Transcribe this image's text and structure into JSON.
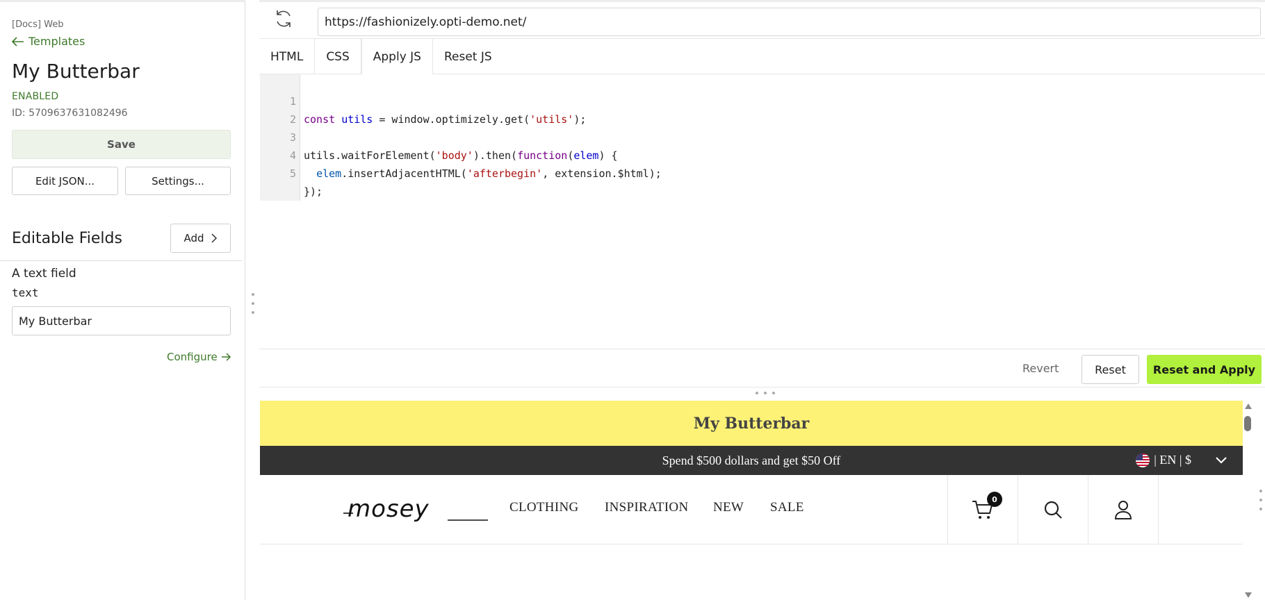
{
  "sidebar": {
    "project": "[Docs] Web",
    "back_label": "Templates",
    "title": "My Butterbar",
    "status": "ENABLED",
    "id_text": "ID: 5709637631082496",
    "save_label": "Save",
    "edit_json_label": "Edit JSON...",
    "settings_label": "Settings...",
    "fields_title": "Editable Fields",
    "add_label": "Add",
    "field": {
      "label": "A text field",
      "key": "text",
      "value": "My Butterbar"
    },
    "configure_label": "Configure"
  },
  "topbar": {
    "url": "https://fashionizely.opti-demo.net/",
    "refresh_icon": "refresh-icon"
  },
  "tabs": [
    {
      "label": "HTML"
    },
    {
      "label": "CSS"
    },
    {
      "label": "Apply JS"
    },
    {
      "label": "Reset JS"
    }
  ],
  "active_tab": "Apply JS",
  "editor": {
    "line_numbers": [
      "1",
      "2",
      "3",
      "4",
      "5"
    ],
    "lines": [
      "const utils = window.optimizely.get('utils');",
      "",
      "utils.waitForElement('body').then(function(elem) {",
      "  elem.insertAdjacentHTML('afterbegin', extension.$html);",
      "});"
    ]
  },
  "actions": {
    "revert_label": "Revert",
    "reset_label": "Reset",
    "apply_label": "Reset and Apply"
  },
  "preview": {
    "butterbar_text": "My Butterbar",
    "promo_text": "Spend $500 dollars and get $50 Off",
    "locale_text": "| EN | $",
    "logo_text": "mosey",
    "nav": [
      "CLOTHING",
      "INSPIRATION",
      "NEW",
      "SALE"
    ],
    "cart_count": "0"
  },
  "colors": {
    "accent_green": "#3f7a2b",
    "apply_button": "#b1f03c",
    "butterbar_bg": "#fdf276",
    "promo_bg": "#333333"
  }
}
